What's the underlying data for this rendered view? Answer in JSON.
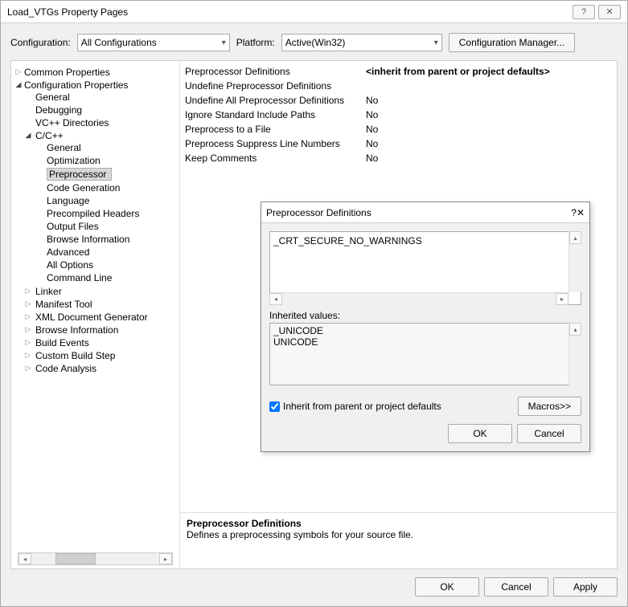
{
  "window": {
    "title": "Load_VTGs Property Pages"
  },
  "toolbar": {
    "config_label": "Configuration:",
    "config_value": "All Configurations",
    "platform_label": "Platform:",
    "platform_value": "Active(Win32)",
    "config_manager": "Configuration Manager..."
  },
  "tree": {
    "common": "Common Properties",
    "config_props": "Configuration Properties",
    "general": "General",
    "debugging": "Debugging",
    "vcdirs": "VC++ Directories",
    "ccpp": "C/C++",
    "cpp_general": "General",
    "cpp_optim": "Optimization",
    "cpp_preproc": "Preprocessor",
    "cpp_codegen": "Code Generation",
    "cpp_lang": "Language",
    "cpp_pch": "Precompiled Headers",
    "cpp_out": "Output Files",
    "cpp_browse": "Browse Information",
    "cpp_adv": "Advanced",
    "cpp_all": "All Options",
    "cpp_cmd": "Command Line",
    "linker": "Linker",
    "manifest": "Manifest Tool",
    "xml": "XML Document Generator",
    "browse": "Browse Information",
    "build": "Build Events",
    "custom": "Custom Build Step",
    "codean": "Code Analysis"
  },
  "props": {
    "r0n": "Preprocessor Definitions",
    "r0v": "<inherit from parent or project defaults>",
    "r1n": "Undefine Preprocessor Definitions",
    "r1v": "",
    "r2n": "Undefine All Preprocessor Definitions",
    "r2v": "No",
    "r3n": "Ignore Standard Include Paths",
    "r3v": "No",
    "r4n": "Preprocess to a File",
    "r4v": "No",
    "r5n": "Preprocess Suppress Line Numbers",
    "r5v": "No",
    "r6n": "Keep Comments",
    "r6v": "No"
  },
  "help": {
    "heading": "Preprocessor Definitions",
    "text": "Defines a preprocessing symbols for your source file."
  },
  "dialog": {
    "title": "Preprocessor Definitions",
    "edit_value": "_CRT_SECURE_NO_WARNINGS",
    "inherited_label": "Inherited values:",
    "inherited_values": [
      "_UNICODE",
      "UNICODE"
    ],
    "inherit_checkbox": "Inherit from parent or project defaults",
    "macros_btn": "Macros>>",
    "ok": "OK",
    "cancel": "Cancel"
  },
  "buttons": {
    "ok": "OK",
    "cancel": "Cancel",
    "apply": "Apply"
  }
}
